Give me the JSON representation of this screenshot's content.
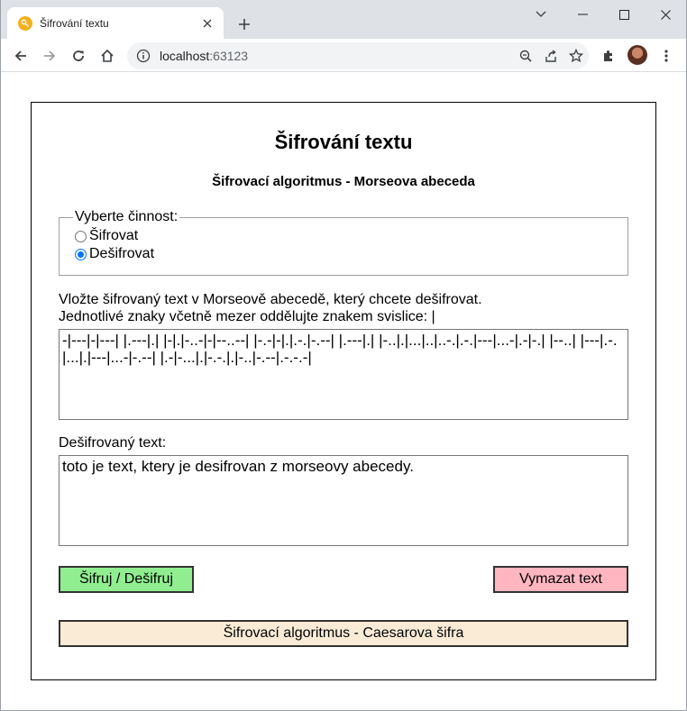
{
  "browser": {
    "tab_title": "Šifrování textu",
    "url_host": "localhost",
    "url_port": ":63123"
  },
  "page": {
    "title": "Šifrování textu",
    "subtitle": "Šifrovací algoritmus - Morseova abeceda",
    "activity": {
      "legend": "Vyberte činnost:",
      "options": [
        {
          "label": "Šifrovat",
          "checked": false
        },
        {
          "label": "Dešifrovat",
          "checked": true
        }
      ]
    },
    "instructions": {
      "line1": "Vložte šifrovaný text v Morseově abecedě, který chcete dešifrovat.",
      "line2": "Jednotlivé znaky včetně mezer oddělujte znakem svislice: |"
    },
    "input_value": "-|---|-|---| |.---|.| |-|.|-..-|-|--..--| |-.-|-|.|.-.|-.--| |.---|.| |-..|.|...|..|..-.|.-.|---|...-|.-|-.| |--..| |---|.-.|...|.|---|...-|-.--| |.-|-...|.|-.-.|.|-..|-.--|.-.-.-|",
    "output_label": "Dešifrovaný text:",
    "output_value": "toto je text, ktery je desifrovan z morseovy abecedy.",
    "buttons": {
      "cipher": "Šifruj / Dešifruj",
      "clear": "Vymazat text",
      "switch_algorithm": "Šifrovací algoritmus - Caesarova šifra"
    }
  },
  "colors": {
    "cipher_button": "#90ee90",
    "clear_button": "#ffb6c1",
    "switch_button": "#faebd7",
    "radio_accent": "#0075ff"
  }
}
